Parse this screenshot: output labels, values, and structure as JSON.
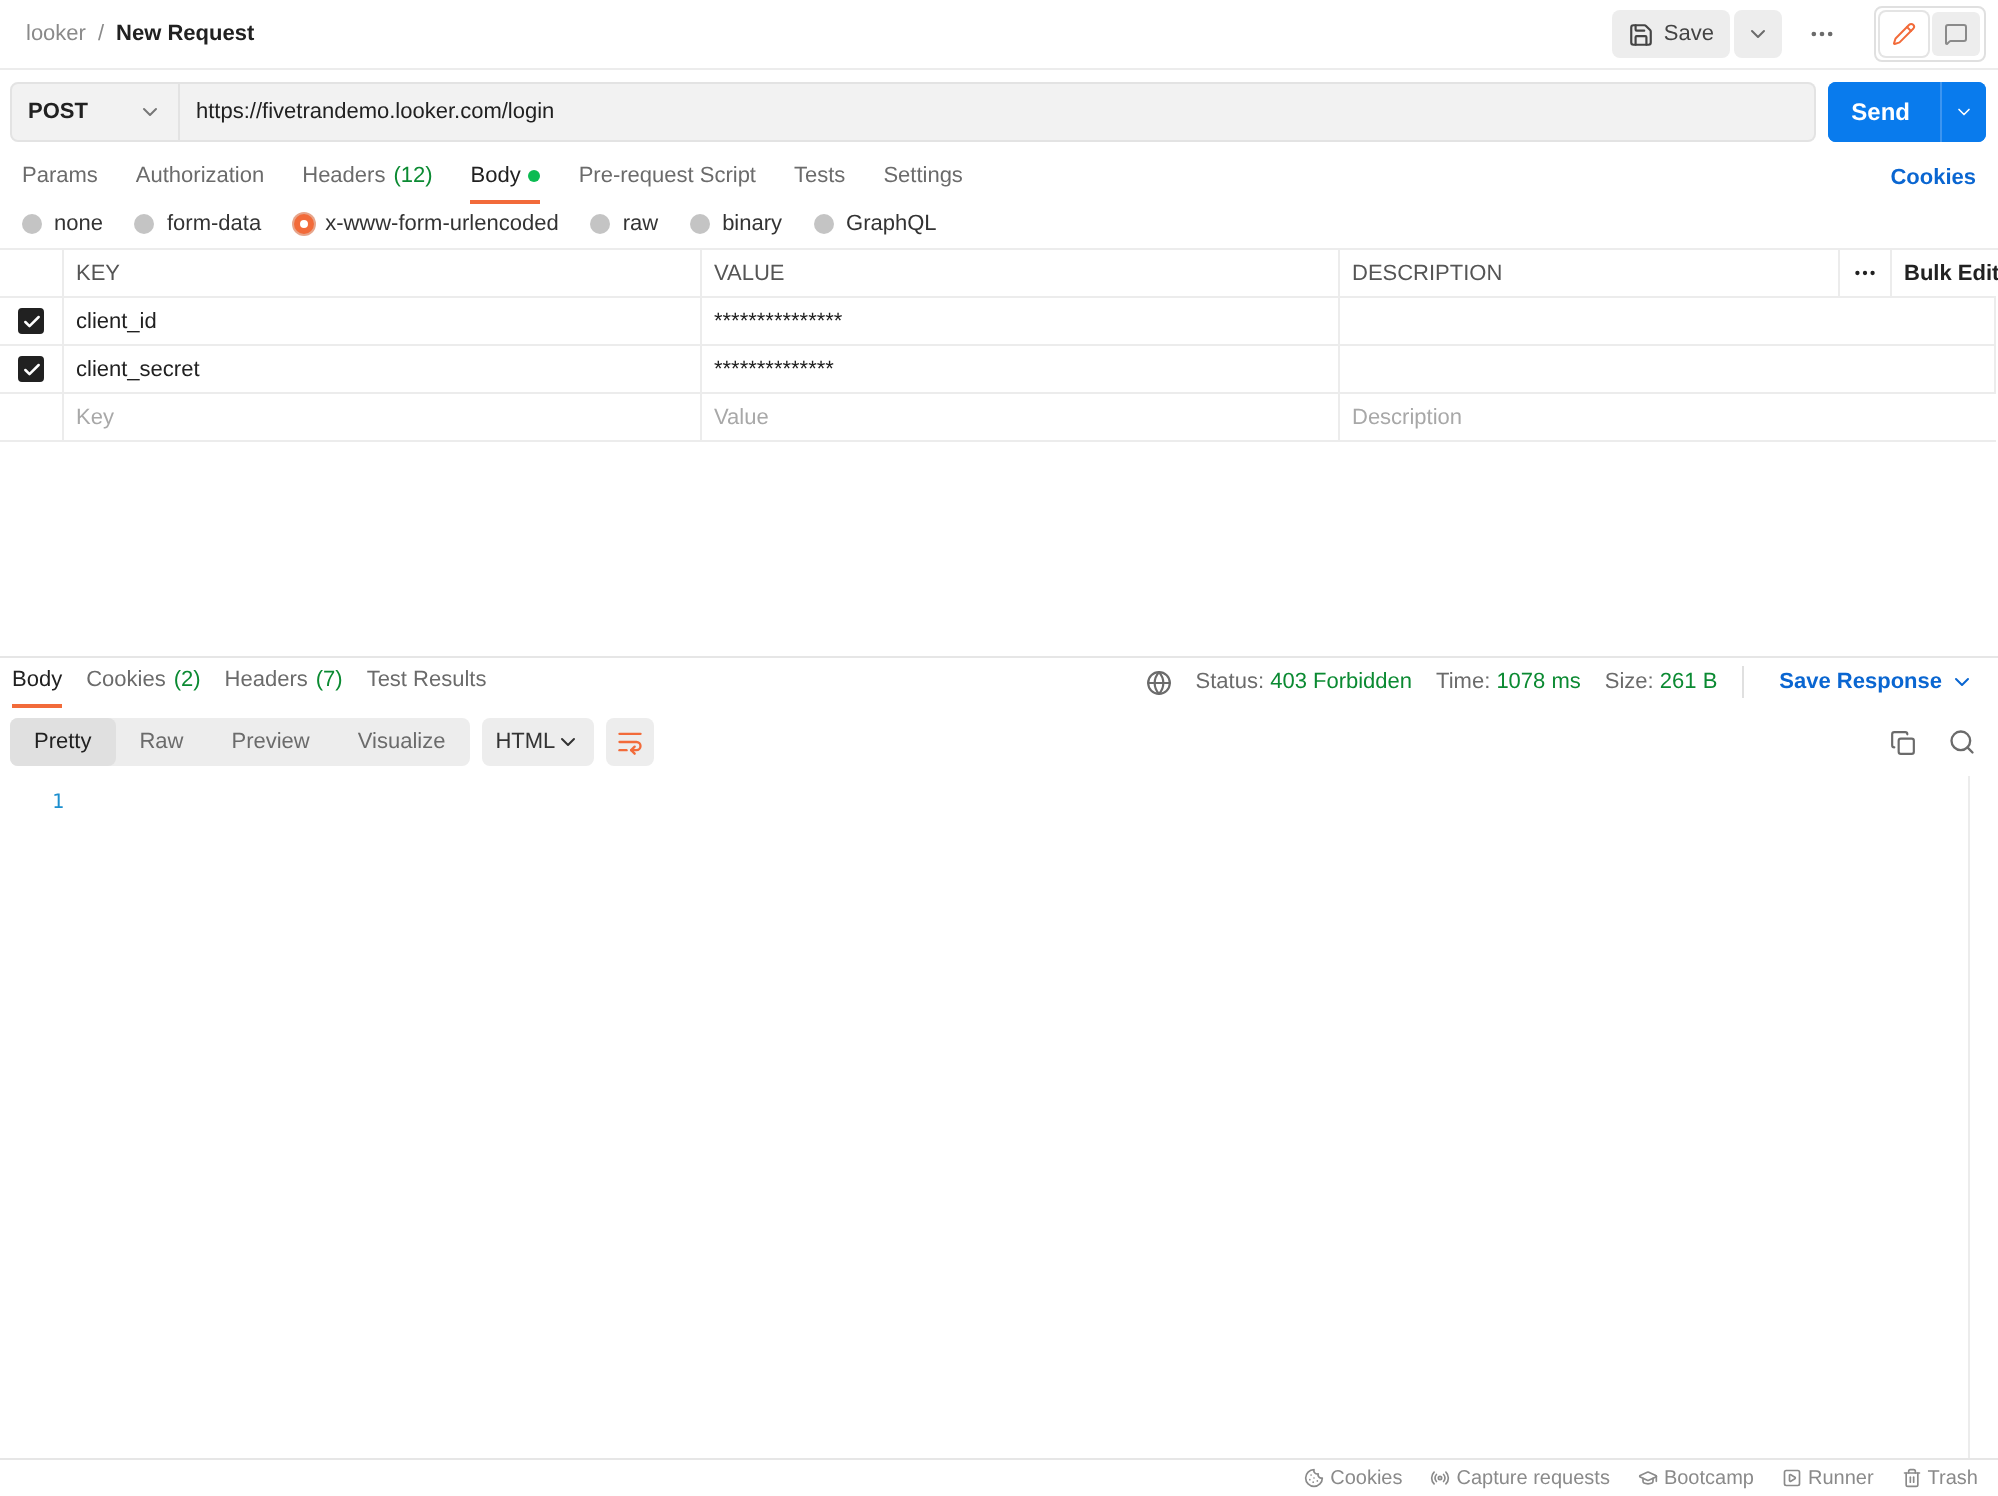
{
  "breadcrumb": {
    "workspace": "looker",
    "separator": "/",
    "request": "New Request"
  },
  "save_button": "Save",
  "view_toggle": [
    {
      "kind": "edit",
      "selected": true
    },
    {
      "kind": "comments",
      "selected": false
    }
  ],
  "request": {
    "method": "POST",
    "url": "https://fivetrandemo.looker.com/login",
    "send": "Send"
  },
  "request_tabs": [
    {
      "label": "Params",
      "selected": false
    },
    {
      "label": "Authorization",
      "selected": false
    },
    {
      "label": "Headers",
      "count": "(12)",
      "selected": false
    },
    {
      "label": "Body",
      "selected": true,
      "indicator": true
    },
    {
      "label": "Pre-request Script",
      "selected": false
    },
    {
      "label": "Tests",
      "selected": false
    },
    {
      "label": "Settings",
      "selected": false
    }
  ],
  "cookies_link": "Cookies",
  "body_types": [
    {
      "label": "none",
      "selected": false
    },
    {
      "label": "form-data",
      "selected": false
    },
    {
      "label": "x-www-form-urlencoded",
      "selected": true
    },
    {
      "label": "raw",
      "selected": false
    },
    {
      "label": "binary",
      "selected": false
    },
    {
      "label": "GraphQL",
      "selected": false
    }
  ],
  "params_table": {
    "columns": [
      "KEY",
      "VALUE",
      "DESCRIPTION"
    ],
    "bulk_edit": "Bulk Edit",
    "rows": [
      {
        "checked": true,
        "key": "client_id",
        "value": "***************"
      },
      {
        "checked": true,
        "key": "client_secret",
        "value": "**************"
      }
    ],
    "new_row": {
      "key": {
        "placeholder": "Key"
      },
      "value": {
        "placeholder": "Value"
      },
      "description": {
        "placeholder": "Description"
      }
    }
  },
  "response_tabs": [
    {
      "label": "Body",
      "selected": true
    },
    {
      "label": "Cookies",
      "count": "(2)",
      "selected": false
    },
    {
      "label": "Headers",
      "count": "(7)",
      "selected": false
    },
    {
      "label": "Test Results",
      "selected": false
    }
  ],
  "response_status": {
    "status_label": "Status:",
    "status": "403 Forbidden",
    "time_label": "Time:",
    "time": "1078 ms",
    "size_label": "Size:",
    "size": "261 B"
  },
  "save_response": "Save Response",
  "format_tabs": [
    {
      "label": "Pretty",
      "selected": true
    },
    {
      "label": "Raw",
      "selected": false
    },
    {
      "label": "Preview",
      "selected": false
    },
    {
      "label": "Visualize",
      "selected": false
    }
  ],
  "language": "HTML",
  "editor": {
    "line_numbers": [
      "1"
    ]
  },
  "status_bar": [
    {
      "kind": "cookies",
      "label": "Cookies"
    },
    {
      "kind": "capture",
      "label": "Capture requests"
    },
    {
      "kind": "bootcamp",
      "label": "Bootcamp"
    },
    {
      "kind": "runner",
      "label": "Runner"
    },
    {
      "kind": "trash",
      "label": "Trash"
    }
  ]
}
